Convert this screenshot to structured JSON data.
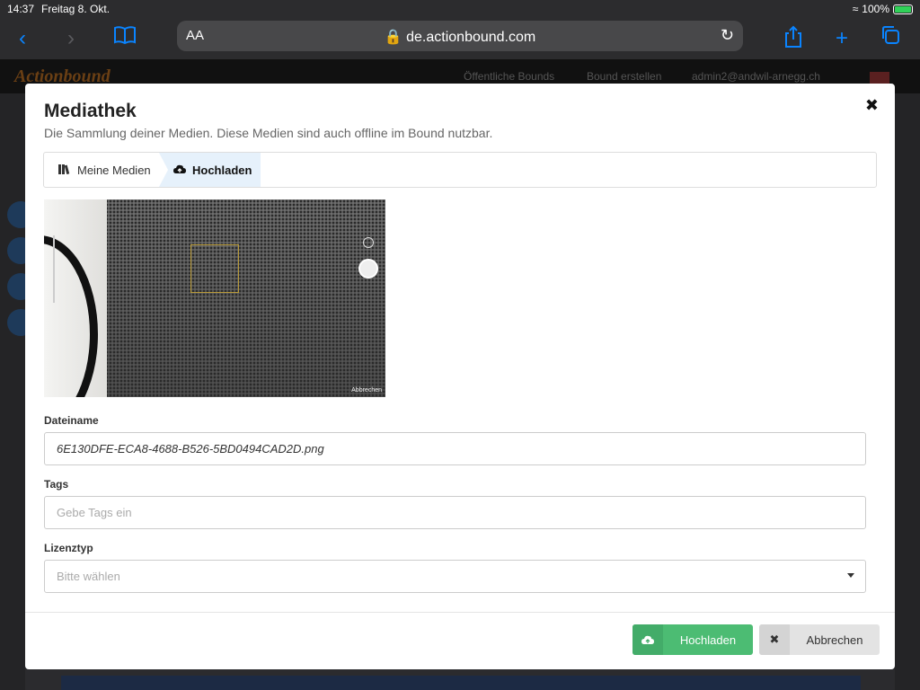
{
  "status_bar": {
    "time": "14:37",
    "date": "Freitag 8. Okt.",
    "battery": "100%"
  },
  "browser": {
    "text_size_label": "AA",
    "url": "de.actionbound.com",
    "icons": [
      "back-icon",
      "forward-icon",
      "bookmarks-icon",
      "lock-icon",
      "reload-icon",
      "share-icon",
      "new-tab-icon",
      "tabs-icon"
    ]
  },
  "site": {
    "logo": "Actionbound",
    "nav": [
      "Öffentliche Bounds",
      "Bound erstellen",
      "admin2@andwil-arnegg.ch"
    ]
  },
  "modal": {
    "title": "Mediathek",
    "subtitle": "Die Sammlung deiner Medien. Diese Medien sind auch offline im Bound nutzbar.",
    "close": "✖",
    "tabs": [
      {
        "label": "Meine Medien",
        "icon": "books-icon",
        "active": false
      },
      {
        "label": "Hochladen",
        "icon": "cloud-upload-icon",
        "active": true
      }
    ],
    "preview_label": "Abbrechen",
    "filename": {
      "label": "Dateiname",
      "value": "6E130DFE-ECA8-4688-B526-5BD0494CAD2D.png"
    },
    "tags": {
      "label": "Tags",
      "placeholder": "Gebe Tags ein"
    },
    "license": {
      "label": "Lizenztyp",
      "placeholder": "Bitte wählen"
    },
    "buttons": {
      "upload": "Hochladen",
      "cancel": "Abbrechen"
    }
  },
  "colors": {
    "upload_button": "#4cbc73",
    "active_tab": "#e6f1fb",
    "browser_accent": "#0a84ff"
  }
}
